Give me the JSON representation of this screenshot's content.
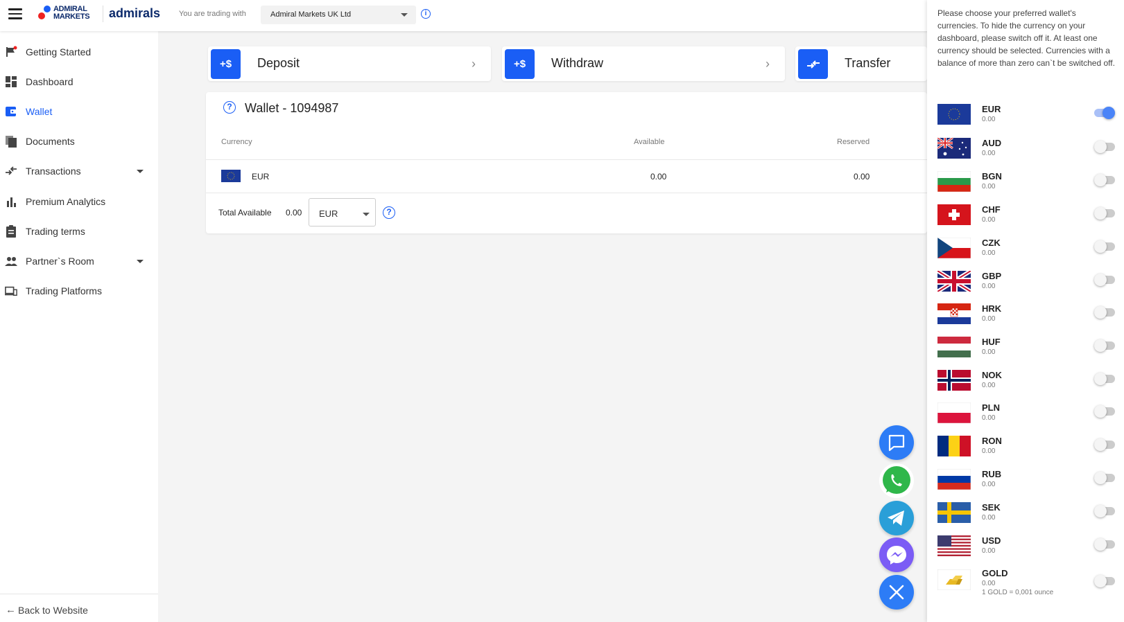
{
  "header": {
    "brand_top": "ADMIRAL",
    "brand_bottom": "MARKETS",
    "brand_name": "admirals",
    "trading_with_label": "You are trading with",
    "entity": "Admiral Markets UK Ltd"
  },
  "sidebar": {
    "items": [
      {
        "label": "Getting Started",
        "icon": "flag-icon"
      },
      {
        "label": "Dashboard",
        "icon": "dashboard-icon"
      },
      {
        "label": "Wallet",
        "icon": "wallet-icon"
      },
      {
        "label": "Documents",
        "icon": "documents-icon"
      },
      {
        "label": "Transactions",
        "icon": "transfer-arrows-icon"
      },
      {
        "label": "Premium Analytics",
        "icon": "bar-chart-icon"
      },
      {
        "label": "Trading terms",
        "icon": "clipboard-icon"
      },
      {
        "label": "Partner`s Room",
        "icon": "people-icon"
      },
      {
        "label": "Trading Platforms",
        "icon": "devices-icon"
      }
    ],
    "active_item": "Wallet",
    "back_label": "Back to Website"
  },
  "actions": {
    "deposit": {
      "label": "Deposit",
      "icon_text": "+$"
    },
    "withdraw": {
      "label": "Withdraw",
      "icon_text": "+$"
    },
    "transfer": {
      "label": "Transfer"
    }
  },
  "wallet": {
    "title": "Wallet - 1094987",
    "columns": {
      "currency": "Currency",
      "available": "Available",
      "reserved": "Reserved"
    },
    "rows": [
      {
        "currency": "EUR",
        "available": "0.00",
        "reserved": "0.00"
      }
    ],
    "total_label": "Total Available",
    "total_value": "0.00",
    "total_currency": "EUR"
  },
  "right_panel": {
    "info": "Please choose your preferred wallet's currencies. To hide the currency on your dashboard, please switch off it. At least one currency should be selected. Currencies with a balance of more than zero can`t be switched off.",
    "currencies": [
      {
        "code": "EUR",
        "balance": "0.00",
        "on": true
      },
      {
        "code": "AUD",
        "balance": "0.00",
        "on": false
      },
      {
        "code": "BGN",
        "balance": "0.00",
        "on": false
      },
      {
        "code": "CHF",
        "balance": "0.00",
        "on": false
      },
      {
        "code": "CZK",
        "balance": "0.00",
        "on": false
      },
      {
        "code": "GBP",
        "balance": "0.00",
        "on": false
      },
      {
        "code": "HRK",
        "balance": "0.00",
        "on": false
      },
      {
        "code": "HUF",
        "balance": "0.00",
        "on": false
      },
      {
        "code": "NOK",
        "balance": "0.00",
        "on": false
      },
      {
        "code": "PLN",
        "balance": "0.00",
        "on": false
      },
      {
        "code": "RON",
        "balance": "0.00",
        "on": false
      },
      {
        "code": "RUB",
        "balance": "0.00",
        "on": false
      },
      {
        "code": "SEK",
        "balance": "0.00",
        "on": false
      },
      {
        "code": "USD",
        "balance": "0.00",
        "on": false
      },
      {
        "code": "GOLD",
        "balance": "0.00",
        "on": false,
        "note": "1 GOLD = 0,001 ounce"
      }
    ]
  },
  "colors": {
    "accent": "#1a5ef5",
    "chat": "#2d7cf6",
    "whatsapp": "#2fb74a",
    "telegram": "#2a9fd8",
    "messenger": "#7b5cf5"
  }
}
